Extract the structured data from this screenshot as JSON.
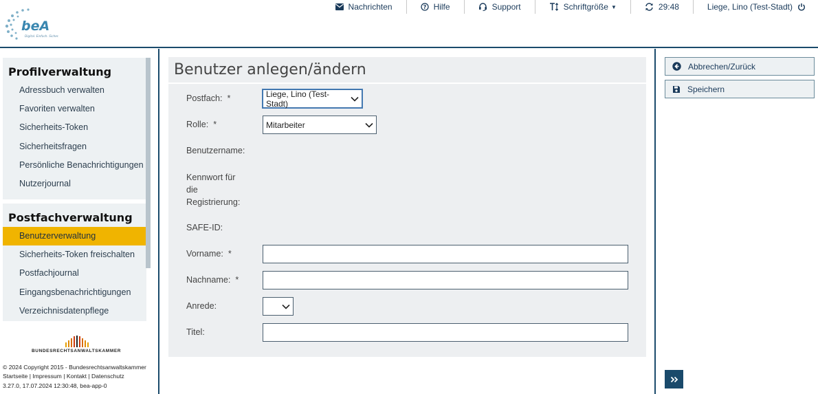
{
  "app": {
    "logo_text": "beA",
    "logo_tagline": "Digital. Einfach. Sicher."
  },
  "topnav": {
    "messages": "Nachrichten",
    "help": "Hilfe",
    "support": "Support",
    "font_size": "Schriftgröße",
    "session_timer": "29:48",
    "user": "Liege, Lino (Test-Stadt)"
  },
  "sidebar": {
    "profile_title": "Profilverwaltung",
    "profile_items": [
      "Adressbuch verwalten",
      "Favoriten verwalten",
      "Sicherheits-Token",
      "Sicherheitsfragen",
      "Persönliche Benachrichtigungen",
      "Nutzerjournal"
    ],
    "mailbox_title": "Postfachverwaltung",
    "mailbox_items": [
      "Benutzerverwaltung",
      "Sicherheits-Token freischalten",
      "Postfachjournal",
      "Eingangsbenachrichtigungen",
      "Verzeichnisdatenpflege"
    ],
    "active_item": "Benutzerverwaltung",
    "brak_label": "BUNDESRECHTSANWALTSKAMMER",
    "footer": {
      "copyright": "© 2024 Copyright 2015 - Bundesrechtsanwaltskammer",
      "link_start": "Startseite",
      "link_impressum": "Impressum",
      "link_contact": "Kontakt",
      "link_privacy": "Datenschutz",
      "separator": " | ",
      "version": "3.27.0, 17.07.2024 12:30:48, bea-app-0"
    }
  },
  "main": {
    "title": "Benutzer anlegen/ändern",
    "form": {
      "postfach_label": "Postfach:",
      "postfach_value": "Liege, Lino (Test-Stadt)",
      "rolle_label": "Rolle:",
      "rolle_value": "Mitarbeiter",
      "benutzername_label": "Benutzername:",
      "kennwort_label_1": "Kennwort für",
      "kennwort_label_2": "die",
      "kennwort_label_3": "Registrierung:",
      "safeid_label": "SAFE-ID:",
      "vorname_label": "Vorname:",
      "vorname_value": "",
      "nachname_label": "Nachname:",
      "nachname_value": "",
      "anrede_label": "Anrede:",
      "anrede_value": "",
      "titel_label": "Titel:",
      "titel_value": "",
      "required_mark": "*"
    }
  },
  "right_panel": {
    "cancel_label": "Abbrechen/Zurück",
    "save_label": "Speichern"
  },
  "colors": {
    "brand_dark": "#1a4a6b",
    "accent_active": "#f0b400",
    "panel_bg": "#edf1f3"
  }
}
